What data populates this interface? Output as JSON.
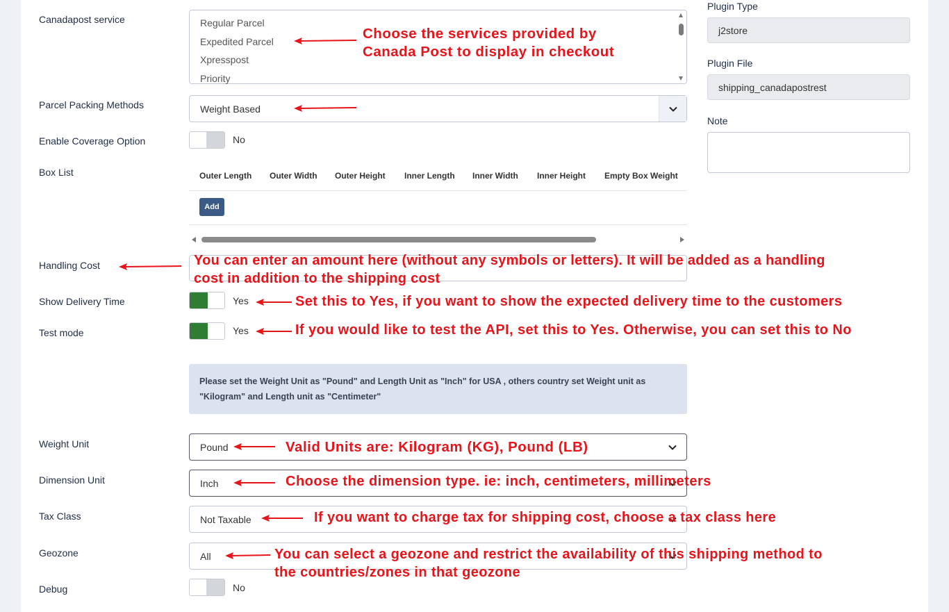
{
  "form": {
    "canadapost_service": {
      "label": "Canadapost service",
      "options": [
        "Regular Parcel",
        "Expedited Parcel",
        "Xpresspost",
        "Priority"
      ]
    },
    "packing": {
      "label": "Parcel Packing Methods",
      "value": "Weight Based"
    },
    "coverage": {
      "label": "Enable Coverage Option",
      "state": "No"
    },
    "box_list": {
      "label": "Box List",
      "columns": [
        "Outer Length",
        "Outer Width",
        "Outer Height",
        "Inner Length",
        "Inner Width",
        "Inner Height",
        "Empty Box Weight"
      ],
      "add_label": "Add"
    },
    "handling_cost": {
      "label": "Handling Cost",
      "value": ""
    },
    "delivery_time": {
      "label": "Show Delivery Time",
      "state": "Yes"
    },
    "test_mode": {
      "label": "Test mode",
      "state": "Yes"
    },
    "info_text": "Please set the Weight Unit as \"Pound\" and Length Unit as \"Inch\" for USA , others country set Weight unit as \"Kilogram\" and Length unit as \"Centimeter\"",
    "weight_unit": {
      "label": "Weight Unit",
      "value": "Pound"
    },
    "dimension_unit": {
      "label": "Dimension Unit",
      "value": "Inch"
    },
    "tax_class": {
      "label": "Tax Class",
      "value": "Not Taxable"
    },
    "geozone": {
      "label": "Geozone",
      "value": "All"
    },
    "debug": {
      "label": "Debug",
      "state": "No"
    }
  },
  "sidebar": {
    "plugin_type": {
      "label": "Plugin Type",
      "value": "j2store"
    },
    "plugin_file": {
      "label": "Plugin File",
      "value": "shipping_canadapostrest"
    },
    "note": {
      "label": "Note",
      "value": ""
    }
  },
  "annotations": {
    "services": [
      "Choose the services provided by",
      "Canada Post to display in checkout"
    ],
    "handling": [
      "You can enter an amount here (without any symbols or letters). It will be added as a handling",
      "cost in addition to the shipping cost"
    ],
    "delivery": "Set this to Yes, if you want to show the expected delivery time to the customers",
    "test": "If you would like to test the API, set this to Yes. Otherwise, you can set this to No",
    "weight": "Valid Units are: Kilogram (KG), Pound (LB)",
    "dimension": "Choose the dimension type. ie: inch, centimeters, millimeters",
    "tax": "If you want to charge tax for shipping cost, choose a tax class here",
    "geozone": [
      "You can select a geozone and restrict the availability of this shipping method to",
      "the countries/zones in that geozone"
    ]
  },
  "colors": {
    "annotation": "#e8141a",
    "toggle_on": "#2e7d32",
    "add_button": "#3b5b86",
    "info_bg": "#dde3ee"
  }
}
